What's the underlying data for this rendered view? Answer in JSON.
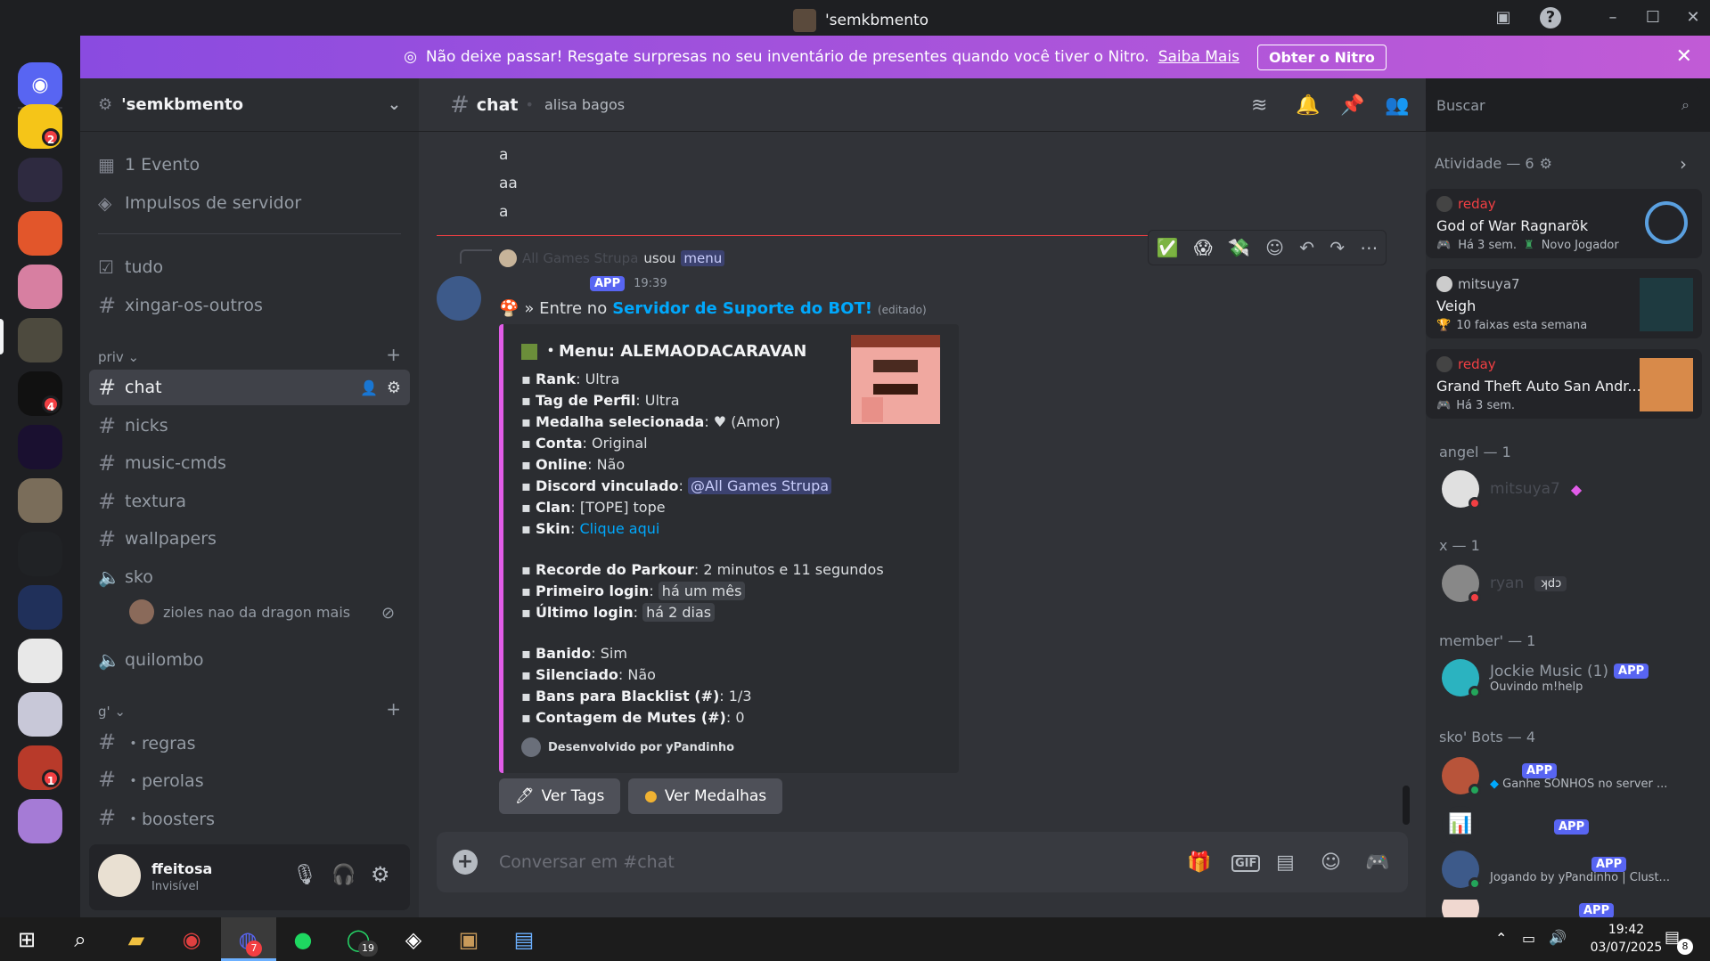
{
  "window": {
    "title": "'semkbmento"
  },
  "banner": {
    "text": "Não deixe passar! Resgate surpresas no seu inventário de presentes quando você tiver o Nitro.",
    "link": "Saiba Mais",
    "button": "Obter o Nitro"
  },
  "rail": {
    "badges": {
      "s1": "2",
      "s6": "4",
      "s13": "1"
    }
  },
  "server": {
    "name": "'semkbmento"
  },
  "sidebar": {
    "top_items": [
      {
        "label": "1 Evento",
        "icon": "calendar-icon"
      },
      {
        "label": "Impulsos de servidor",
        "icon": "boost-icon"
      }
    ],
    "items": [
      {
        "label": "tudo",
        "icon": "check-square-icon"
      },
      {
        "label": "xingar-os-outros",
        "icon": "hash-icon"
      }
    ],
    "categories": {
      "priv": "priv",
      "g": "g'"
    },
    "priv_channels": [
      {
        "label": "chat"
      },
      {
        "label": "nicks"
      },
      {
        "label": "music-cmds"
      },
      {
        "label": "textura"
      },
      {
        "label": "wallpapers"
      }
    ],
    "voice": [
      {
        "label": "sko"
      },
      {
        "label": "quilombo"
      }
    ],
    "voice_user": "zioles nao da dragon mais",
    "g_channels": [
      {
        "label": "・regras"
      },
      {
        "label": "・perolas"
      },
      {
        "label": "・boosters"
      }
    ]
  },
  "user": {
    "name": "ffeitosa",
    "status": "Invisível"
  },
  "chat": {
    "channel": "chat",
    "topic": "alisa bagos",
    "search_placeholder": "Buscar",
    "messages": [
      "a",
      "aa",
      "a"
    ],
    "reply_user": "All Games Strupa",
    "reply_used": "usou",
    "reply_command": "menu",
    "bot_badge": "APP",
    "time": "19:39",
    "content_prefix": "» Entre no",
    "content_link": "Servidor de Suporte do BOT!",
    "content_edited": "(editado)",
    "composer_placeholder": "Conversar em #chat"
  },
  "embed": {
    "title": "・Menu: ALEMAODACARAVAN",
    "rows": [
      {
        "k": "Rank",
        "v": ": Ultra"
      },
      {
        "k": "Tag de Perfil",
        "v": ": Ultra"
      },
      {
        "k": "Medalha selecionada",
        "v": ": ♥ (Amor)"
      },
      {
        "k": "Conta",
        "v": ": Original"
      },
      {
        "k": "Online",
        "v": ": Não"
      },
      {
        "k": "Discord vinculado",
        "v": ": "
      },
      {
        "k": "Clan",
        "v": ": [TOPE] tope"
      },
      {
        "k": "Skin",
        "v": ": "
      }
    ],
    "discord_mention": "@All Games Strupa",
    "skin_link": "Clique aqui",
    "rows2": [
      {
        "k": "Recorde do Parkour",
        "v": ": 2 minutos e 11 segundos"
      },
      {
        "k": "Primeiro login",
        "v": ": "
      },
      {
        "k": "Último login",
        "v": ": "
      }
    ],
    "first_login": "há um mês",
    "last_login": "há 2 dias",
    "rows3": [
      {
        "k": "Banido",
        "v": ": Sim"
      },
      {
        "k": "Silenciado",
        "v": ": Não"
      },
      {
        "k": "Bans para Blacklist (#)",
        "v": ": 1/3"
      },
      {
        "k": "Contagem de Mutes (#)",
        "v": ": 0"
      }
    ],
    "footer": "Desenvolvido por yPandinho"
  },
  "buttons": {
    "tags": "Ver Tags",
    "medals": "Ver Medalhas"
  },
  "activity": {
    "header": "Atividade — 6",
    "cards": [
      {
        "user": "reday",
        "title": "God of War Ragnarök",
        "meta": "Há 3 sem.",
        "extra": "Novo Jogador"
      },
      {
        "user": "mitsuya7",
        "title": "Veigh",
        "meta": "10 faixas esta semana",
        "extra": ""
      },
      {
        "user": "reday",
        "title": "Grand Theft Auto San Andr...",
        "meta": "Há 3 sem.",
        "extra": ""
      }
    ]
  },
  "members": {
    "angel": "angel — 1",
    "angel_user": "mitsuya7",
    "x": "x — 1",
    "x_user": "ryan",
    "x_tag": "ʞdɔ",
    "member": "member' — 1",
    "jockie": "Jockie Music (1)",
    "jockie_status": "Ouvindo m!help",
    "bots": "sko' Bots — 4",
    "bot1_status": "Ganhe SONHOS no server ...",
    "bot3_status": "Jogando by yPandinho | Clust...",
    "app": "APP"
  },
  "taskbar": {
    "time": "19:42",
    "date": "03/07/2025",
    "notif": "8",
    "discord_badge": "7",
    "wa_badge": "19"
  }
}
